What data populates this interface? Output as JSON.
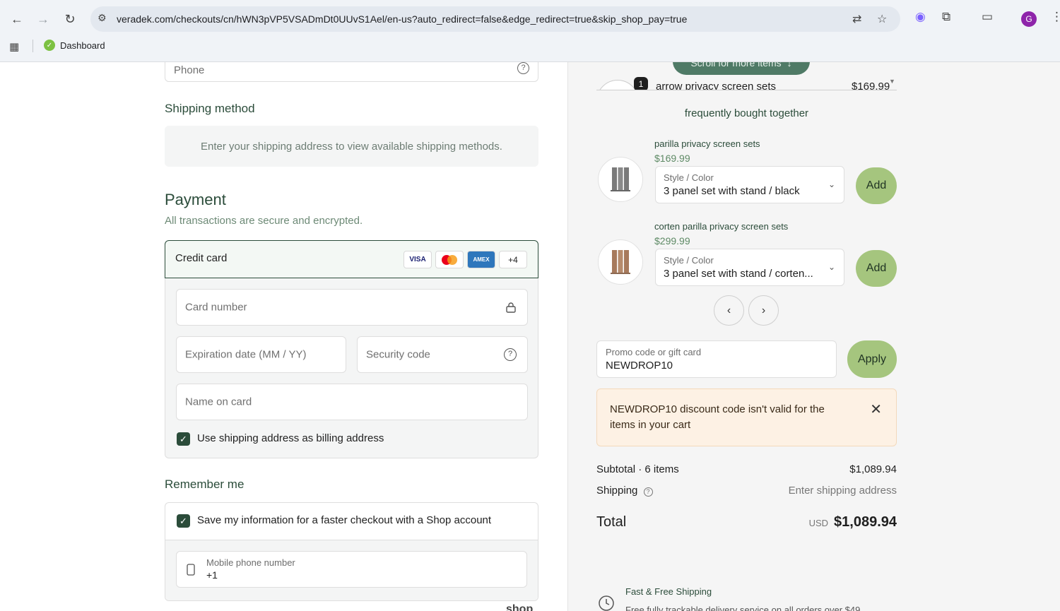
{
  "browser": {
    "url": "veradek.com/checkouts/cn/hWN3pVP5VSADmDt0UUvS1Ael/en-us?auto_redirect=false&edge_redirect=true&skip_shop_pay=true",
    "avatar_letter": "G",
    "bookmark_label": "Dashboard"
  },
  "contact": {
    "phone_placeholder": "Phone"
  },
  "shipping_method": {
    "title": "Shipping method",
    "message": "Enter your shipping address to view available shipping methods."
  },
  "payment": {
    "title": "Payment",
    "subtitle": "All transactions are secure and encrypted.",
    "method_label": "Credit card",
    "cards": [
      "VISA",
      "",
      "AMEX",
      "+4"
    ],
    "card_number_placeholder": "Card number",
    "expiration_placeholder": "Expiration date (MM / YY)",
    "security_placeholder": "Security code",
    "name_placeholder": "Name on card",
    "billing_checkbox_label": "Use shipping address as billing address"
  },
  "remember": {
    "title": "Remember me",
    "save_label": "Save my information for a faster checkout with a Shop account",
    "mobile_label": "Mobile phone number",
    "mobile_value": "+1",
    "shop_partial": "shop"
  },
  "cart": {
    "scroll_hint": "Scroll for more items",
    "partial_item_qty": "1",
    "partial_item_name": "arrow privacy screen sets",
    "partial_item_price": "$169.99"
  },
  "fbt": {
    "title": "frequently bought together",
    "products": [
      {
        "name": "parilla privacy screen sets",
        "price": "$169.99",
        "option_label": "Style / Color",
        "option_value": "3 panel set with stand / black",
        "add": "Add",
        "color": "#7a7a7a"
      },
      {
        "name": "corten parilla privacy screen sets",
        "price": "$299.99",
        "option_label": "Style / Color",
        "option_value": "3 panel set with stand / corten...",
        "add": "Add",
        "color": "#a77a5c"
      }
    ]
  },
  "promo": {
    "label": "Promo code or gift card",
    "value": "NEWDROP10",
    "apply": "Apply",
    "error": "NEWDROP10 discount code isn't valid for the items in your cart"
  },
  "summary": {
    "subtotal_label": "Subtotal · 6 items",
    "subtotal_value": "$1,089.94",
    "shipping_label": "Shipping",
    "shipping_value": "Enter shipping address",
    "total_label": "Total",
    "currency": "USD",
    "total_value": "$1,089.94"
  },
  "perk": {
    "title": "Fast & Free Shipping",
    "text": "Free fully trackable delivery service on all orders over $49"
  }
}
